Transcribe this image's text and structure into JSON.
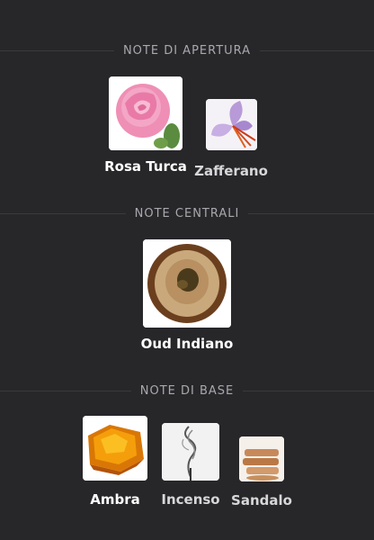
{
  "sections": [
    {
      "title": "NOTE DI APERTURA",
      "notes": [
        {
          "name": "Rosa Turca",
          "icon": "rose-icon"
        },
        {
          "name": "Zafferano",
          "icon": "saffron-flower-icon"
        }
      ]
    },
    {
      "title": "NOTE CENTRALI",
      "notes": [
        {
          "name": "Oud Indiano",
          "icon": "oud-wood-icon"
        }
      ]
    },
    {
      "title": "NOTE DI BASE",
      "notes": [
        {
          "name": "Ambra",
          "icon": "amber-resin-icon"
        },
        {
          "name": "Incenso",
          "icon": "incense-smoke-icon"
        },
        {
          "name": "Sandalo",
          "icon": "sandalwood-sticks-icon"
        }
      ]
    }
  ]
}
